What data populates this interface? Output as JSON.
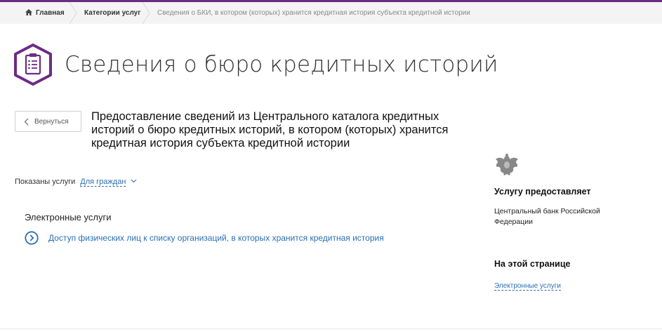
{
  "colors": {
    "accent": "#6d2b86",
    "link": "#2b6fb3",
    "breadcrumb_bg": "#f4f4f4"
  },
  "breadcrumbs": {
    "home": "Главная",
    "category": "Категории услуг",
    "current": "Сведения о БКИ, в котором (которых) хранится кредитная история субъекта кредитной истории"
  },
  "header": {
    "icon": "clipboard-list-icon",
    "title": "Сведения о бюро кредитных историй"
  },
  "back_button": {
    "label": "Вернуться",
    "icon": "chevron-left-icon"
  },
  "service": {
    "title": "Предоставление сведений из Центрального каталога кредитных историй о бюро кредитных историй, в котором (которых) хранится кредитная история субъекта кредитной истории"
  },
  "filter": {
    "label": "Показаны услуги",
    "selected": "Для граждан",
    "icon": "chevron-down-icon"
  },
  "electronic": {
    "section_title": "Электронные услуги",
    "items": [
      {
        "label": "Доступ физических лиц к списку организаций, в которых хранится кредитная история",
        "icon": "arrow-circle-right-icon"
      }
    ]
  },
  "sidebar": {
    "emblem": "double-headed-eagle-emblem-icon",
    "provider_heading": "Услугу предоставляет",
    "provider_name": "Центральный банк Российской Федерации",
    "onpage_heading": "На этой странице",
    "onpage_link": "Электронные услуги"
  }
}
